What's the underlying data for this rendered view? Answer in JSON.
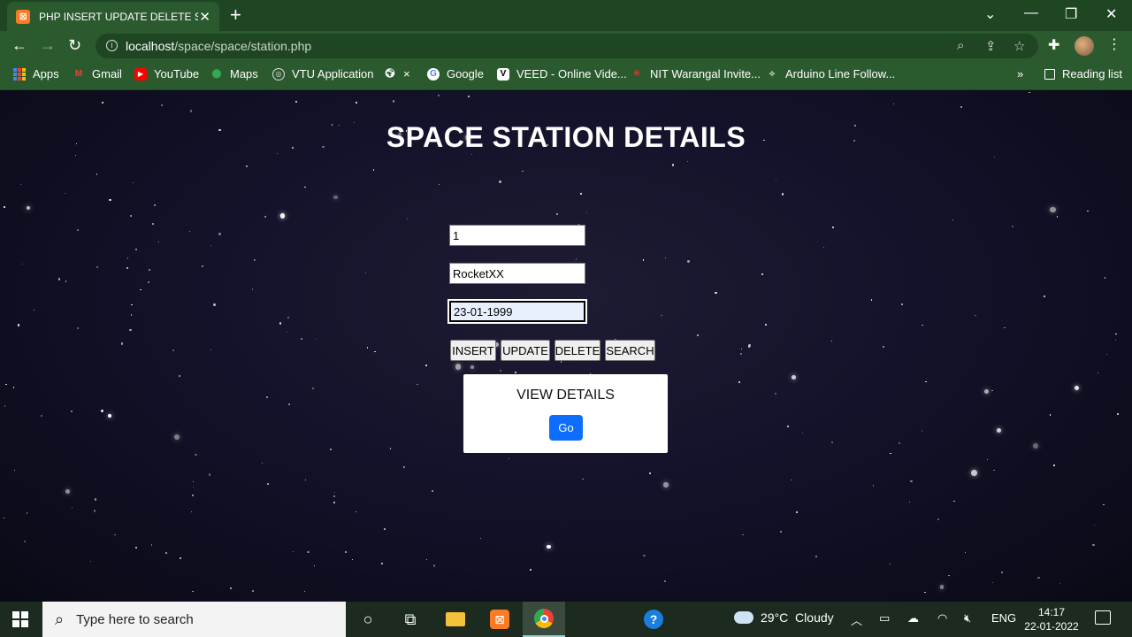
{
  "browser": {
    "tab_title": "PHP INSERT UPDATE DELETE SEA",
    "url_host": "localhost",
    "url_path": "/space/space/station.php",
    "bookmarks": [
      "Apps",
      "Gmail",
      "YouTube",
      "Maps",
      "VTU Application",
      "×",
      "Google",
      "VEED - Online Vide...",
      "NIT Warangal Invite...",
      "Arduino Line Follow..."
    ],
    "overflow": "»",
    "reading_list": "Reading list"
  },
  "page": {
    "heading": "SPACE STATION DETAILS",
    "fields": {
      "id_value": "1",
      "name_value": "RocketXX",
      "date_value": "23-01-1999"
    },
    "buttons": {
      "insert": "INSERT",
      "update": "UPDATE",
      "delete": "DELETE",
      "search": "SEARCH"
    },
    "view_panel": {
      "title": "VIEW DETAILS",
      "go": "Go"
    }
  },
  "taskbar": {
    "search_placeholder": "Type here to search",
    "weather": "29°C  Cloudy",
    "lang": "ENG",
    "time": "14:17",
    "date": "22-01-2022"
  }
}
